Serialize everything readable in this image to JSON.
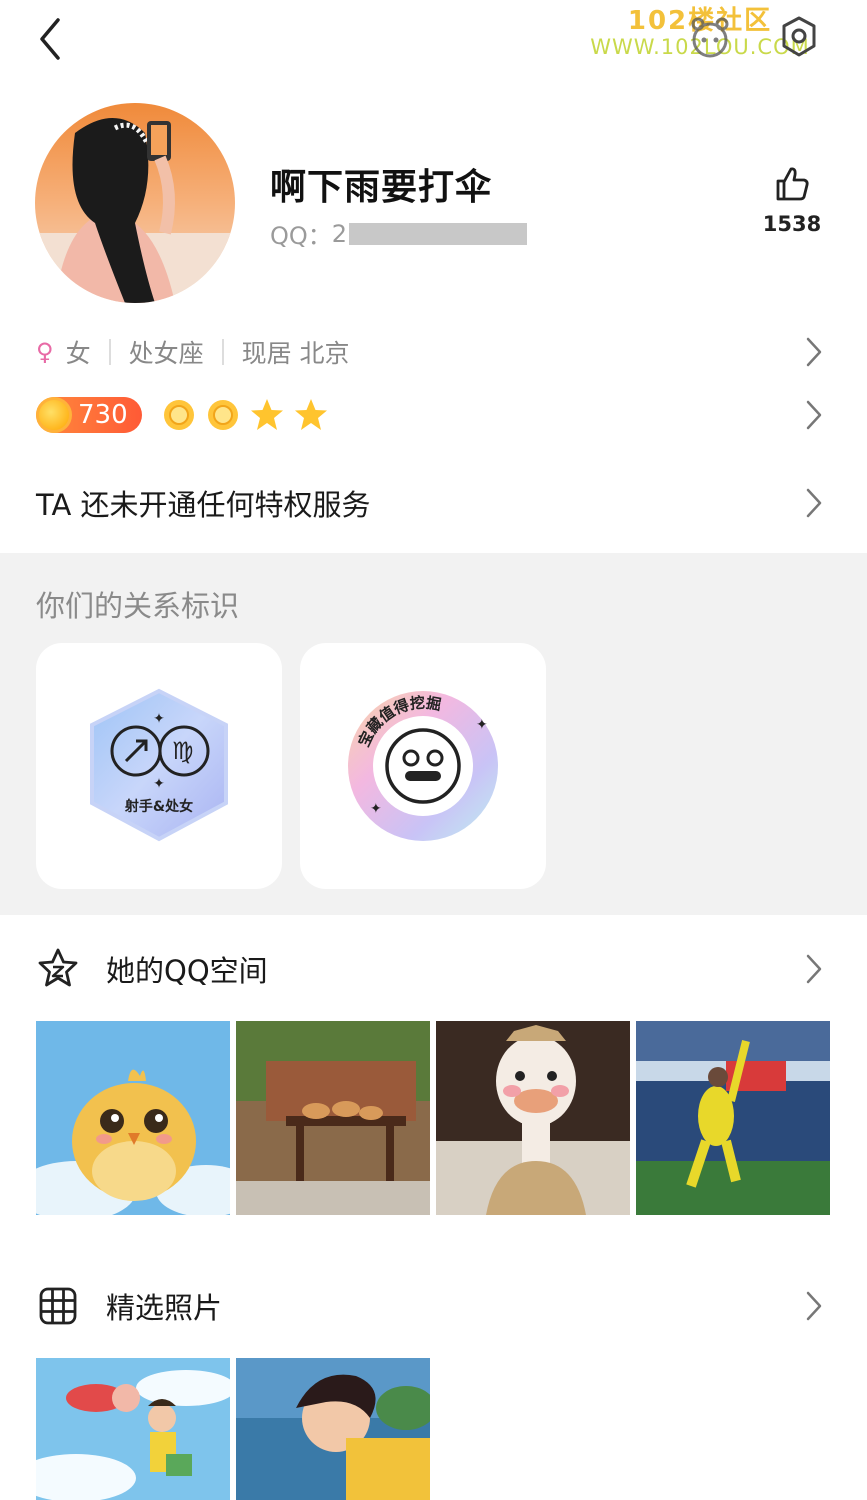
{
  "watermark": {
    "line1": "102楼社区",
    "line2": "WWW.102LOU.COM"
  },
  "profile": {
    "nickname": "啊下雨要打伞",
    "qq_label": "QQ：",
    "qq_prefix": "2",
    "likes": "1538"
  },
  "info": {
    "gender": "女",
    "zodiac": "处女座",
    "location": "现居 北京"
  },
  "level": {
    "value": "730",
    "icons": [
      "sun-icon",
      "sun-icon",
      "star-icon",
      "star-icon"
    ]
  },
  "privilege_text": "TA 还未开通任何特权服务",
  "relation": {
    "title": "你们的关系标识",
    "badges": [
      {
        "name": "zodiac-match-badge",
        "text": "射手&处女"
      },
      {
        "name": "treasure-badge",
        "text": "宝藏值得挖掘"
      }
    ]
  },
  "qzone": {
    "label": "她的QQ空间"
  },
  "photos": {
    "label": "精选照片"
  },
  "colors": {
    "accent_orange": "#ff6a3a",
    "female_pink": "#e86aa6",
    "section_bg": "#f2f2f2"
  }
}
